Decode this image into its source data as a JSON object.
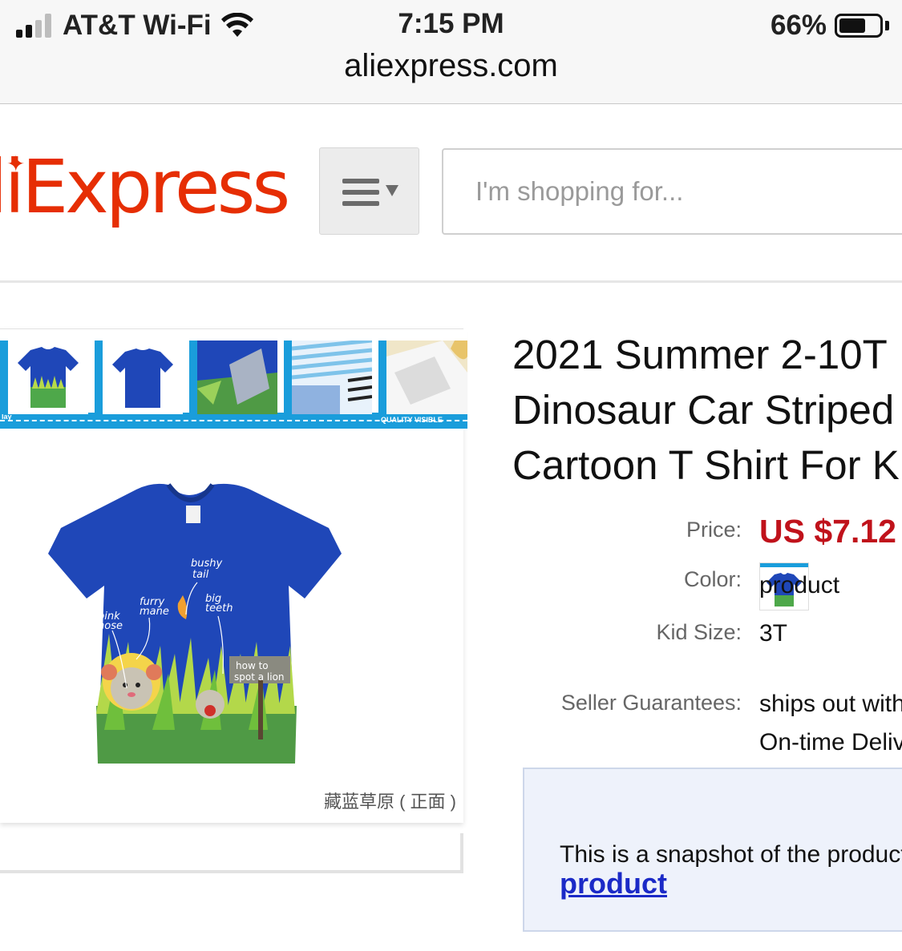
{
  "status_bar": {
    "carrier": "AT&T Wi-Fi",
    "time": "7:15 PM",
    "battery_percent": "66%",
    "battery_level": 0.66,
    "signal_bars": 2
  },
  "browser": {
    "address": "aliexpress.com"
  },
  "header": {
    "logo_text": "liExpress",
    "menu_icon": "menu-caret-icon",
    "search_placeholder": "I'm shopping for..."
  },
  "gallery": {
    "thumbnails": [
      "tshirt-front-thumb",
      "tshirt-back-thumb",
      "fabric-detail-thumb",
      "striped-shirts-thumb",
      "collar-detail-thumb"
    ],
    "caption": "藏蓝草原 ( 正面 )",
    "main_image_text": {
      "bushy_tail": "bushy tail",
      "big_teeth": "big teeth",
      "furry_mane": "furry mane",
      "pink_nose": "pink nose",
      "sign": "how to spot a lion"
    }
  },
  "product": {
    "title_lines": [
      "2021 Summer 2-10T",
      "Dinosaur Car Striped",
      "Cartoon T Shirt For K"
    ],
    "price_label": "Price:",
    "price": "US $7.12",
    "color_label": "Color:",
    "color_value": "product",
    "size_label": "Kid Size:",
    "size_value": "3T",
    "guarantee_label": "Seller Guarantees:",
    "guarantee_lines": [
      "ships out with",
      "On-time Deliv"
    ]
  },
  "snapshot": {
    "message": "This is a snapshot of the product",
    "link": "product"
  },
  "colors": {
    "brand": "#e62e04",
    "price": "#c0121b",
    "link": "#1b2ac7",
    "thumb_strip": "#1a9ddb",
    "shirt": "#1f47b8"
  }
}
